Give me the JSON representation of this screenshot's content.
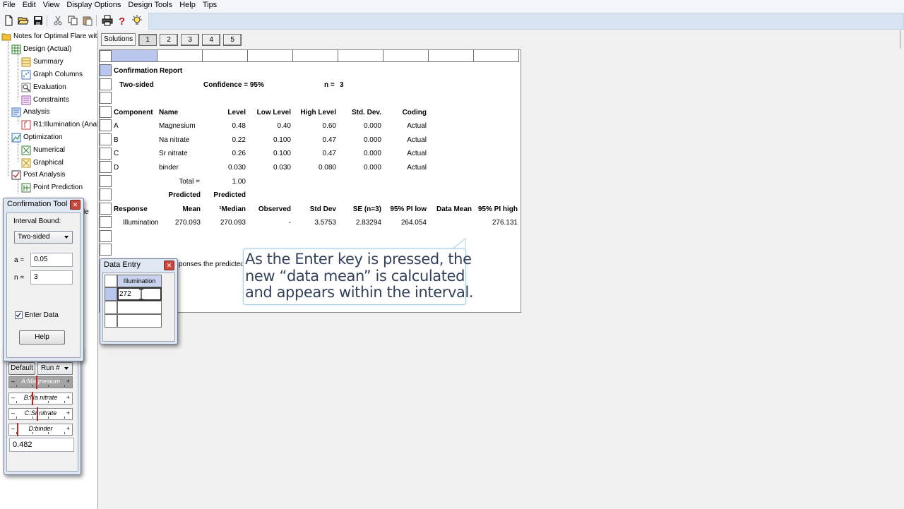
{
  "menu": [
    "File",
    "Edit",
    "View",
    "Display Options",
    "Design Tools",
    "Help",
    "Tips"
  ],
  "toolbar": {
    "icons": [
      "new-file-icon",
      "open-folder-icon",
      "save-icon",
      "cut-icon",
      "copy-icon",
      "paste-icon",
      "print-icon",
      "help-icon",
      "tip-bulb-icon"
    ]
  },
  "tree": {
    "root": "Notes for Optimal Flare wit",
    "design": "Design (Actual)",
    "summary": "Summary",
    "graph_columns": "Graph Columns",
    "evaluation": "Evaluation",
    "constraints": "Constraints",
    "analysis": "Analysis",
    "r1": "R1:Illumination (Anal",
    "optimization": "Optimization",
    "numerical": "Numerical",
    "graphical": "Graphical",
    "post_analysis": "Post Analysis",
    "point_prediction": "Point Prediction",
    "peek": "le"
  },
  "solutions": {
    "label": "Solutions",
    "tabs": [
      "1",
      "2",
      "3",
      "4",
      "5"
    ]
  },
  "report": {
    "title": "Confirmation Report",
    "two_sided": "Two-sided",
    "confidence": "Confidence = 95%",
    "n_label": "n =",
    "n_value": "3",
    "component_headers": [
      "Component",
      "Name",
      "Level",
      "Low Level",
      "High Level",
      "Std. Dev.",
      "Coding"
    ],
    "components": [
      {
        "id": "A",
        "name": "Magnesium",
        "level": "0.48",
        "low": "0.40",
        "high": "0.60",
        "sd": "0.000",
        "coding": "Actual"
      },
      {
        "id": "B",
        "name": "Na nitrate",
        "level": "0.22",
        "low": "0.100",
        "high": "0.47",
        "sd": "0.000",
        "coding": "Actual"
      },
      {
        "id": "C",
        "name": "Sr nitrate",
        "level": "0.26",
        "low": "0.100",
        "high": "0.47",
        "sd": "0.000",
        "coding": "Actual"
      },
      {
        "id": "D",
        "name": "binder",
        "level": "0.030",
        "low": "0.030",
        "high": "0.080",
        "sd": "0.000",
        "coding": "Actual"
      }
    ],
    "total_label": "Total =",
    "total_value": "1.00",
    "predicted1": "Predicted",
    "predicted2": "Predicted",
    "response_headers": [
      "Response",
      "Mean",
      "¹Median",
      "Observed",
      "Std Dev",
      "SE (n=3)",
      "95% PI low",
      "Data Mean",
      "95% PI high"
    ],
    "response": {
      "name": "Illumination",
      "mean": "270.093",
      "median": "270.093",
      "observed": "-",
      "std_dev": "3.5753",
      "se": "2.83294",
      "pi_low": "264.054",
      "data_mean": "",
      "pi_high": "276.131"
    },
    "footnote_fragment": "ponses the predicted"
  },
  "callout": {
    "lines": [
      "As the Enter key is pressed, the",
      "new “data mean” is calculated",
      "and appears within the interval."
    ]
  },
  "confirmation_tool": {
    "title": "Confirmation Tool",
    "interval_bound_label": "Interval Bound:",
    "interval_bound_value": "Two-sided",
    "alpha_label": "a =",
    "alpha_value": "0.05",
    "n_label": "n =",
    "n_value": "3",
    "enter_data_label": "Enter Data",
    "enter_data_checked": true,
    "help_label": "Help"
  },
  "factors_tool": {
    "default_label": "Default",
    "run_label": "Run #",
    "sliders": [
      {
        "label": "A:Magnesium",
        "active": true,
        "position": 0.4
      },
      {
        "label": "B:Na nitrate",
        "active": false,
        "position": 0.32
      },
      {
        "label": "C:Sr nitrate",
        "active": false,
        "position": 0.42
      },
      {
        "label": "D:binder",
        "active": false,
        "position": 0.0
      }
    ],
    "value": "0.482"
  },
  "data_entry": {
    "title": "Data Entry",
    "column": "Illumination",
    "rows": [
      "272",
      "",
      ""
    ]
  }
}
